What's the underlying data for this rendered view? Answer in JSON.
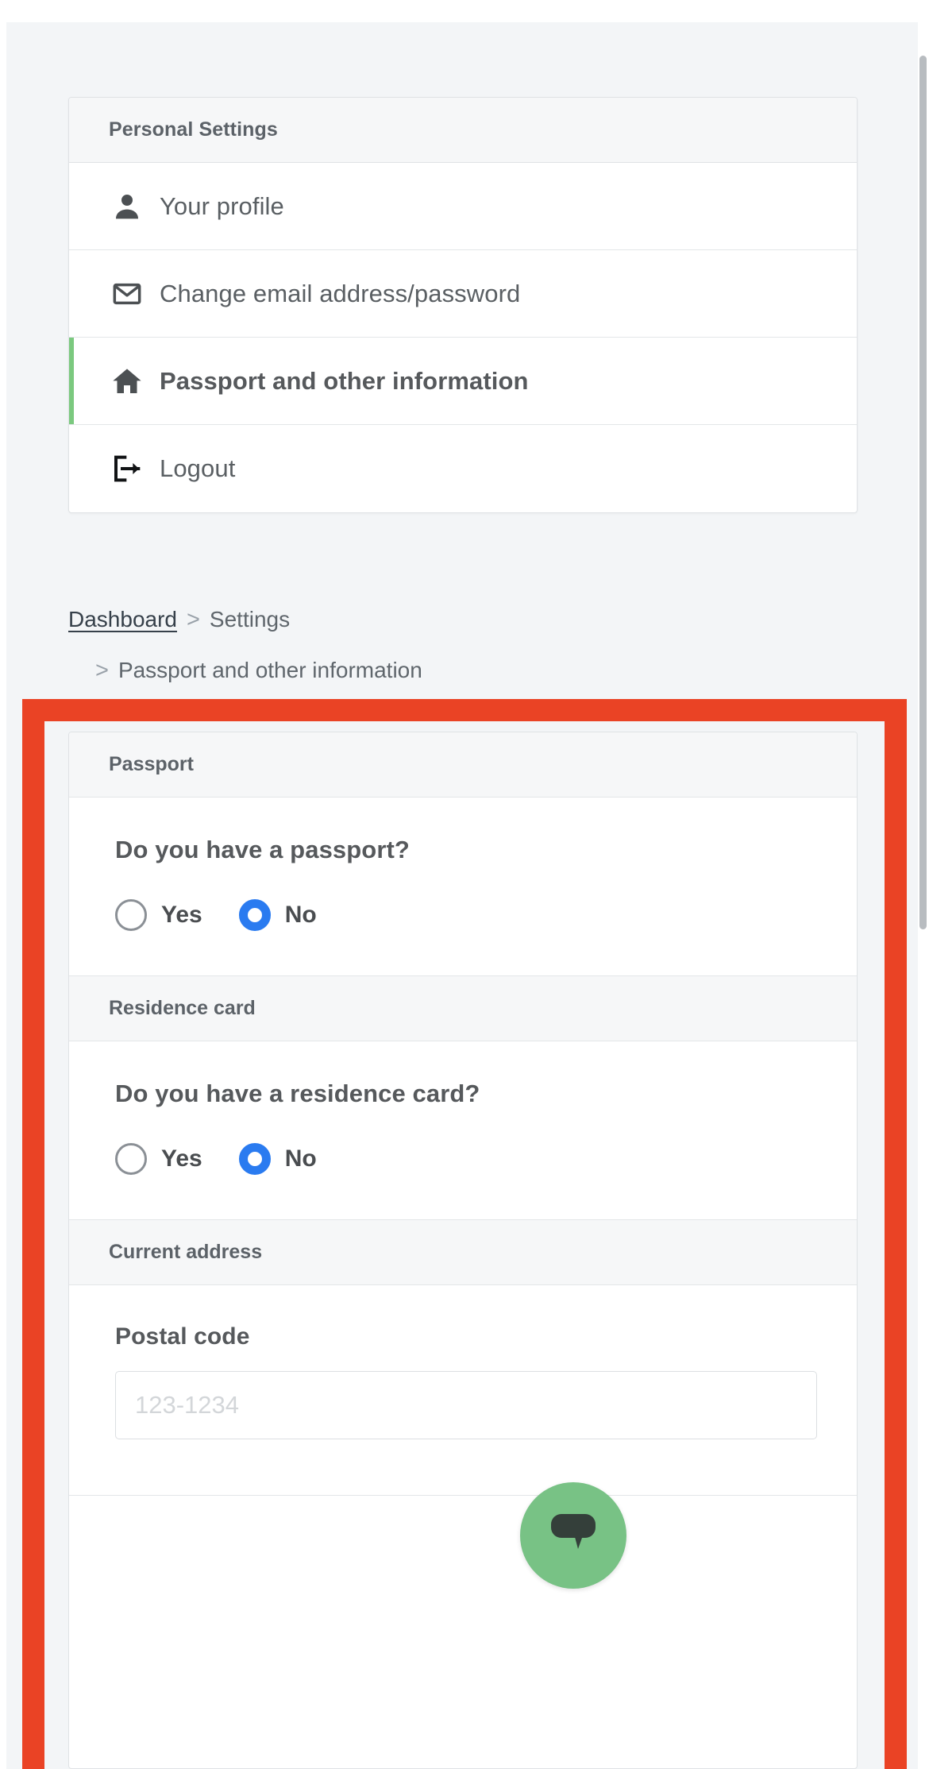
{
  "sidebar": {
    "title": "Personal Settings",
    "items": [
      {
        "label": "Your profile",
        "icon": "person-icon",
        "active": false
      },
      {
        "label": "Change email address/password",
        "icon": "mail-icon",
        "active": false
      },
      {
        "label": "Passport and other information",
        "icon": "home-icon",
        "active": true
      },
      {
        "label": "Logout",
        "icon": "logout-icon",
        "active": false
      }
    ]
  },
  "breadcrumb": {
    "home": "Dashboard",
    "separator": ">",
    "section": "Settings",
    "current": "Passport and other information"
  },
  "sections": [
    {
      "header": "Passport",
      "question": "Do you have a passport?",
      "options": [
        {
          "label": "Yes",
          "checked": false
        },
        {
          "label": "No",
          "checked": true
        }
      ]
    },
    {
      "header": "Residence card",
      "question": "Do you have a residence card?",
      "options": [
        {
          "label": "Yes",
          "checked": false
        },
        {
          "label": "No",
          "checked": true
        }
      ]
    },
    {
      "header": "Current address",
      "field_label": "Postal code",
      "field_value": "",
      "field_placeholder": "123-1234"
    }
  ],
  "chat_widget": {
    "icon": "chat-bubble-icon"
  },
  "colors": {
    "accent_green": "#7bc97f",
    "highlight_red": "#ea4325",
    "radio_blue": "#2a7bf0",
    "chat_green": "#78c285",
    "page_bg": "#f3f5f7",
    "card_header_bg": "#f6f7f8",
    "border": "#dfe2e5",
    "text": "#56595c"
  }
}
